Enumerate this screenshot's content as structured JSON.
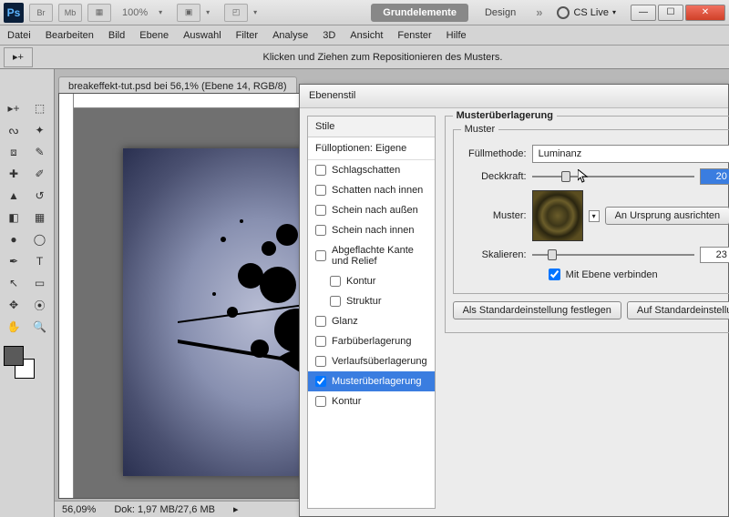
{
  "titlebar": {
    "zoom": "100%",
    "pill1": "Grundelemente",
    "pill2": "Design",
    "cs": "CS Live"
  },
  "menu": [
    "Datei",
    "Bearbeiten",
    "Bild",
    "Ebene",
    "Auswahl",
    "Filter",
    "Analyse",
    "3D",
    "Ansicht",
    "Fenster",
    "Hilfe"
  ],
  "optionsHint": "Klicken und Ziehen zum Repositionieren des Musters.",
  "docTab": "breakeffekt-tut.psd bei 56,1% (Ebene 14, RGB/8)",
  "status": {
    "zoom": "56,09%",
    "doc": "Dok: 1,97 MB/27,6 MB"
  },
  "dialog": {
    "title": "Ebenenstil",
    "stylesHeader": "Stile",
    "fillOptions": "Fülloptionen: Eigene",
    "items": [
      {
        "label": "Schlagschatten",
        "checked": false
      },
      {
        "label": "Schatten nach innen",
        "checked": false
      },
      {
        "label": "Schein nach außen",
        "checked": false
      },
      {
        "label": "Schein nach innen",
        "checked": false
      },
      {
        "label": "Abgeflachte Kante und Relief",
        "checked": false
      },
      {
        "label": "Kontur",
        "checked": false,
        "indent": true
      },
      {
        "label": "Struktur",
        "checked": false,
        "indent": true
      },
      {
        "label": "Glanz",
        "checked": false
      },
      {
        "label": "Farbüberlagerung",
        "checked": false
      },
      {
        "label": "Verlaufsüberlagerung",
        "checked": false
      },
      {
        "label": "Musterüberlagerung",
        "checked": true,
        "sel": true
      },
      {
        "label": "Kontur",
        "checked": false
      }
    ],
    "group1": "Musterüberlagerung",
    "group2": "Muster",
    "fillModeLabel": "Füllmethode:",
    "fillModeValue": "Luminanz",
    "opacityLabel": "Deckkraft:",
    "opacityValue": "20",
    "patternLabel": "Muster:",
    "originBtn": "An Ursprung ausrichten",
    "scaleLabel": "Skalieren:",
    "scaleValue": "23",
    "linkLabel": "Mit Ebene verbinden",
    "defaultBtn": "Als Standardeinstellung festlegen",
    "resetBtn": "Auf Standardeinstellung"
  },
  "icons": {
    "br": "Br",
    "mb": "Mb"
  }
}
